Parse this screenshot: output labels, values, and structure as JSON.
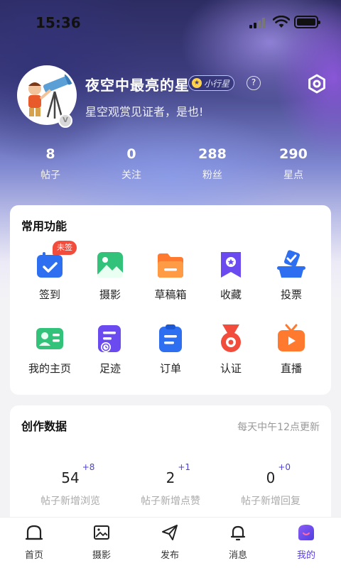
{
  "status_bar": {
    "time": "15:36"
  },
  "profile": {
    "name": "夜空中最亮的星",
    "level": "小行星",
    "bio": "星空观赏见证者，是也!",
    "avatar_badge": "V"
  },
  "stats": [
    {
      "value": "8",
      "label": "帖子"
    },
    {
      "value": "0",
      "label": "关注"
    },
    {
      "value": "288",
      "label": "粉丝"
    },
    {
      "value": "290",
      "label": "星点"
    }
  ],
  "common_functions": {
    "title": "常用功能",
    "items": [
      {
        "label": "签到",
        "icon": "checkin-calendar-icon",
        "tag": "未签"
      },
      {
        "label": "摄影",
        "icon": "photo-icon"
      },
      {
        "label": "草稿箱",
        "icon": "folder-icon"
      },
      {
        "label": "收藏",
        "icon": "bookmark-star-icon"
      },
      {
        "label": "投票",
        "icon": "ballot-box-icon"
      },
      {
        "label": "我的主页",
        "icon": "profile-card-icon"
      },
      {
        "label": "足迹",
        "icon": "footprint-icon"
      },
      {
        "label": "订单",
        "icon": "order-clipboard-icon"
      },
      {
        "label": "认证",
        "icon": "medal-icon"
      },
      {
        "label": "直播",
        "icon": "live-tv-icon"
      }
    ]
  },
  "creation_data": {
    "title": "创作数据",
    "note": "每天中午12点更新",
    "metrics": [
      {
        "value": "54",
        "delta": "+8",
        "label": "帖子新增浏览"
      },
      {
        "value": "2",
        "delta": "+1",
        "label": "帖子新增点赞"
      },
      {
        "value": "0",
        "delta": "+0",
        "label": "帖子新增回复"
      }
    ]
  },
  "tabbar": {
    "items": [
      {
        "label": "首页",
        "icon": "home-icon"
      },
      {
        "label": "摄影",
        "icon": "photo-icon"
      },
      {
        "label": "发布",
        "icon": "send-icon"
      },
      {
        "label": "消息",
        "icon": "bell-icon"
      },
      {
        "label": "我的",
        "icon": "me-icon"
      }
    ],
    "active": "我的"
  },
  "colors": {
    "accent": "#5b3fe6",
    "tag_red": "#f24c3d"
  }
}
